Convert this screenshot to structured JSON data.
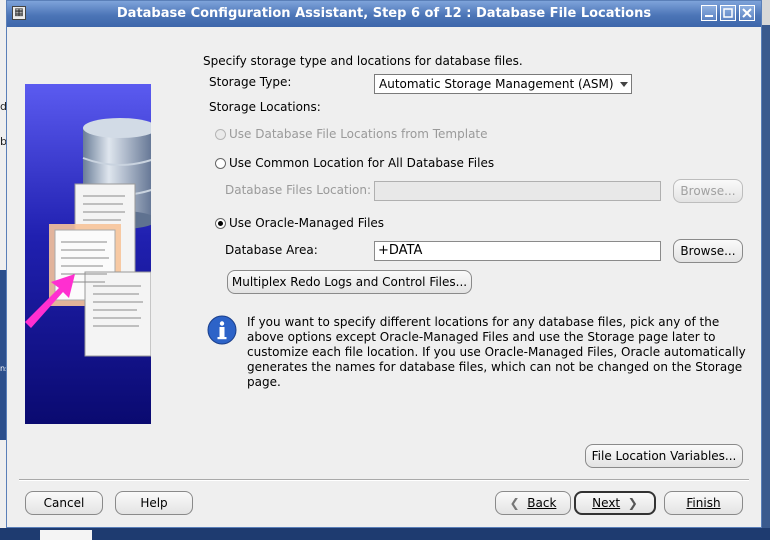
{
  "window": {
    "title": "Database Configuration Assistant, Step 6 of 12 : Database File Locations"
  },
  "desktop": {
    "fragments": [
      "d",
      "b",
      "ns"
    ]
  },
  "content": {
    "intro": "Specify storage type and locations for database files.",
    "storage_type_label": "Storage Type:",
    "storage_type_value": "Automatic Storage Management (ASM)",
    "storage_locations_label": "Storage Locations:",
    "options": {
      "template": "Use Database File Locations from Template",
      "common": "Use Common Location for All Database Files",
      "db_files_location_label": "Database Files Location:",
      "db_files_location_value": "",
      "browse": "Browse...",
      "omf": "Use Oracle-Managed Files",
      "db_area_label": "Database Area:",
      "db_area_value": "+DATA",
      "browse2": "Browse...",
      "multiplex": "Multiplex Redo Logs and Control Files..."
    },
    "info": "If you want to specify different locations for any database files, pick any of the above options except Oracle-Managed Files and use the Storage page later to customize each file location. If you use Oracle-Managed Files, Oracle automatically generates the names for database files, which can not be changed on the Storage page.",
    "file_location_variables": "File Location Variables..."
  },
  "footer": {
    "cancel": "Cancel",
    "help": "Help",
    "back": "Back",
    "next": "Next",
    "finish": "Finish"
  },
  "colors": {
    "titlebar": "#4c75b7",
    "illustration_top": "#5b5bf0",
    "illustration_bottom": "#0a0a70",
    "info_icon": "#2d63c8",
    "arrow": "#ff2fd0"
  },
  "icons": [
    "app-icon",
    "minimize-icon",
    "maximize-icon",
    "close-icon",
    "database-icon",
    "documents-icon",
    "pointer-arrow-icon",
    "info-icon",
    "back-chevron-icon",
    "next-chevron-icon"
  ]
}
